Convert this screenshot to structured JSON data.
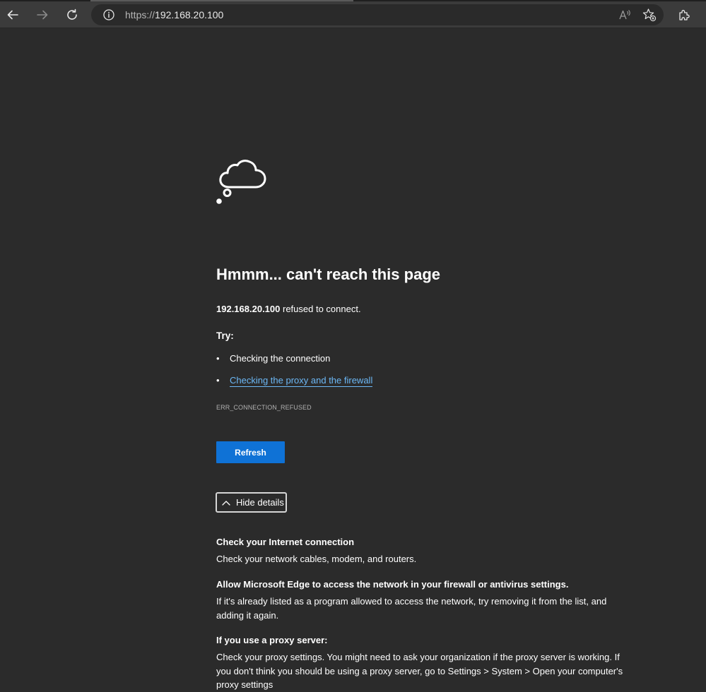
{
  "browser": {
    "url_scheme": "https://",
    "url_host": "192.168.20.100"
  },
  "icons": {
    "back": "back-arrow-icon",
    "forward": "forward-arrow-icon",
    "reload": "reload-icon",
    "site_info": "info-icon",
    "read_aloud": "read-aloud-icon",
    "favorites": "add-favorite-icon",
    "extensions": "extensions-icon",
    "error_illustration": "thought-cloud-icon",
    "details_toggle": "chevron-up-icon"
  },
  "error_page": {
    "headline": "Hmmm... can't reach this page",
    "host": "192.168.20.100",
    "refused_suffix": " refused to connect.",
    "try_label": "Try:",
    "suggestions": [
      {
        "text": "Checking the connection"
      },
      {
        "text": "Checking the proxy and the firewall"
      }
    ],
    "error_code": "ERR_CONNECTION_REFUSED",
    "refresh_label": "Refresh",
    "hide_details_label": "Hide details",
    "details": [
      {
        "title": "Check your Internet connection",
        "body": "Check your network cables, modem, and routers."
      },
      {
        "title": "Allow Microsoft Edge to access the network in your firewall or antivirus settings.",
        "body": "If it's already listed as a program allowed to access the network, try removing it from the list, and adding it again."
      },
      {
        "title": "If you use a proxy server:",
        "body": "Check your proxy settings. You might need to ask your organization if the proxy server is working. If you don't think you should be using a proxy server, go to Settings > System > Open your computer's proxy settings"
      }
    ]
  },
  "colors": {
    "page_bg": "#2b2b2b",
    "toolbar_bg": "#3b3b3b",
    "link": "#6cb8f6",
    "button_primary": "#0f72d6"
  }
}
